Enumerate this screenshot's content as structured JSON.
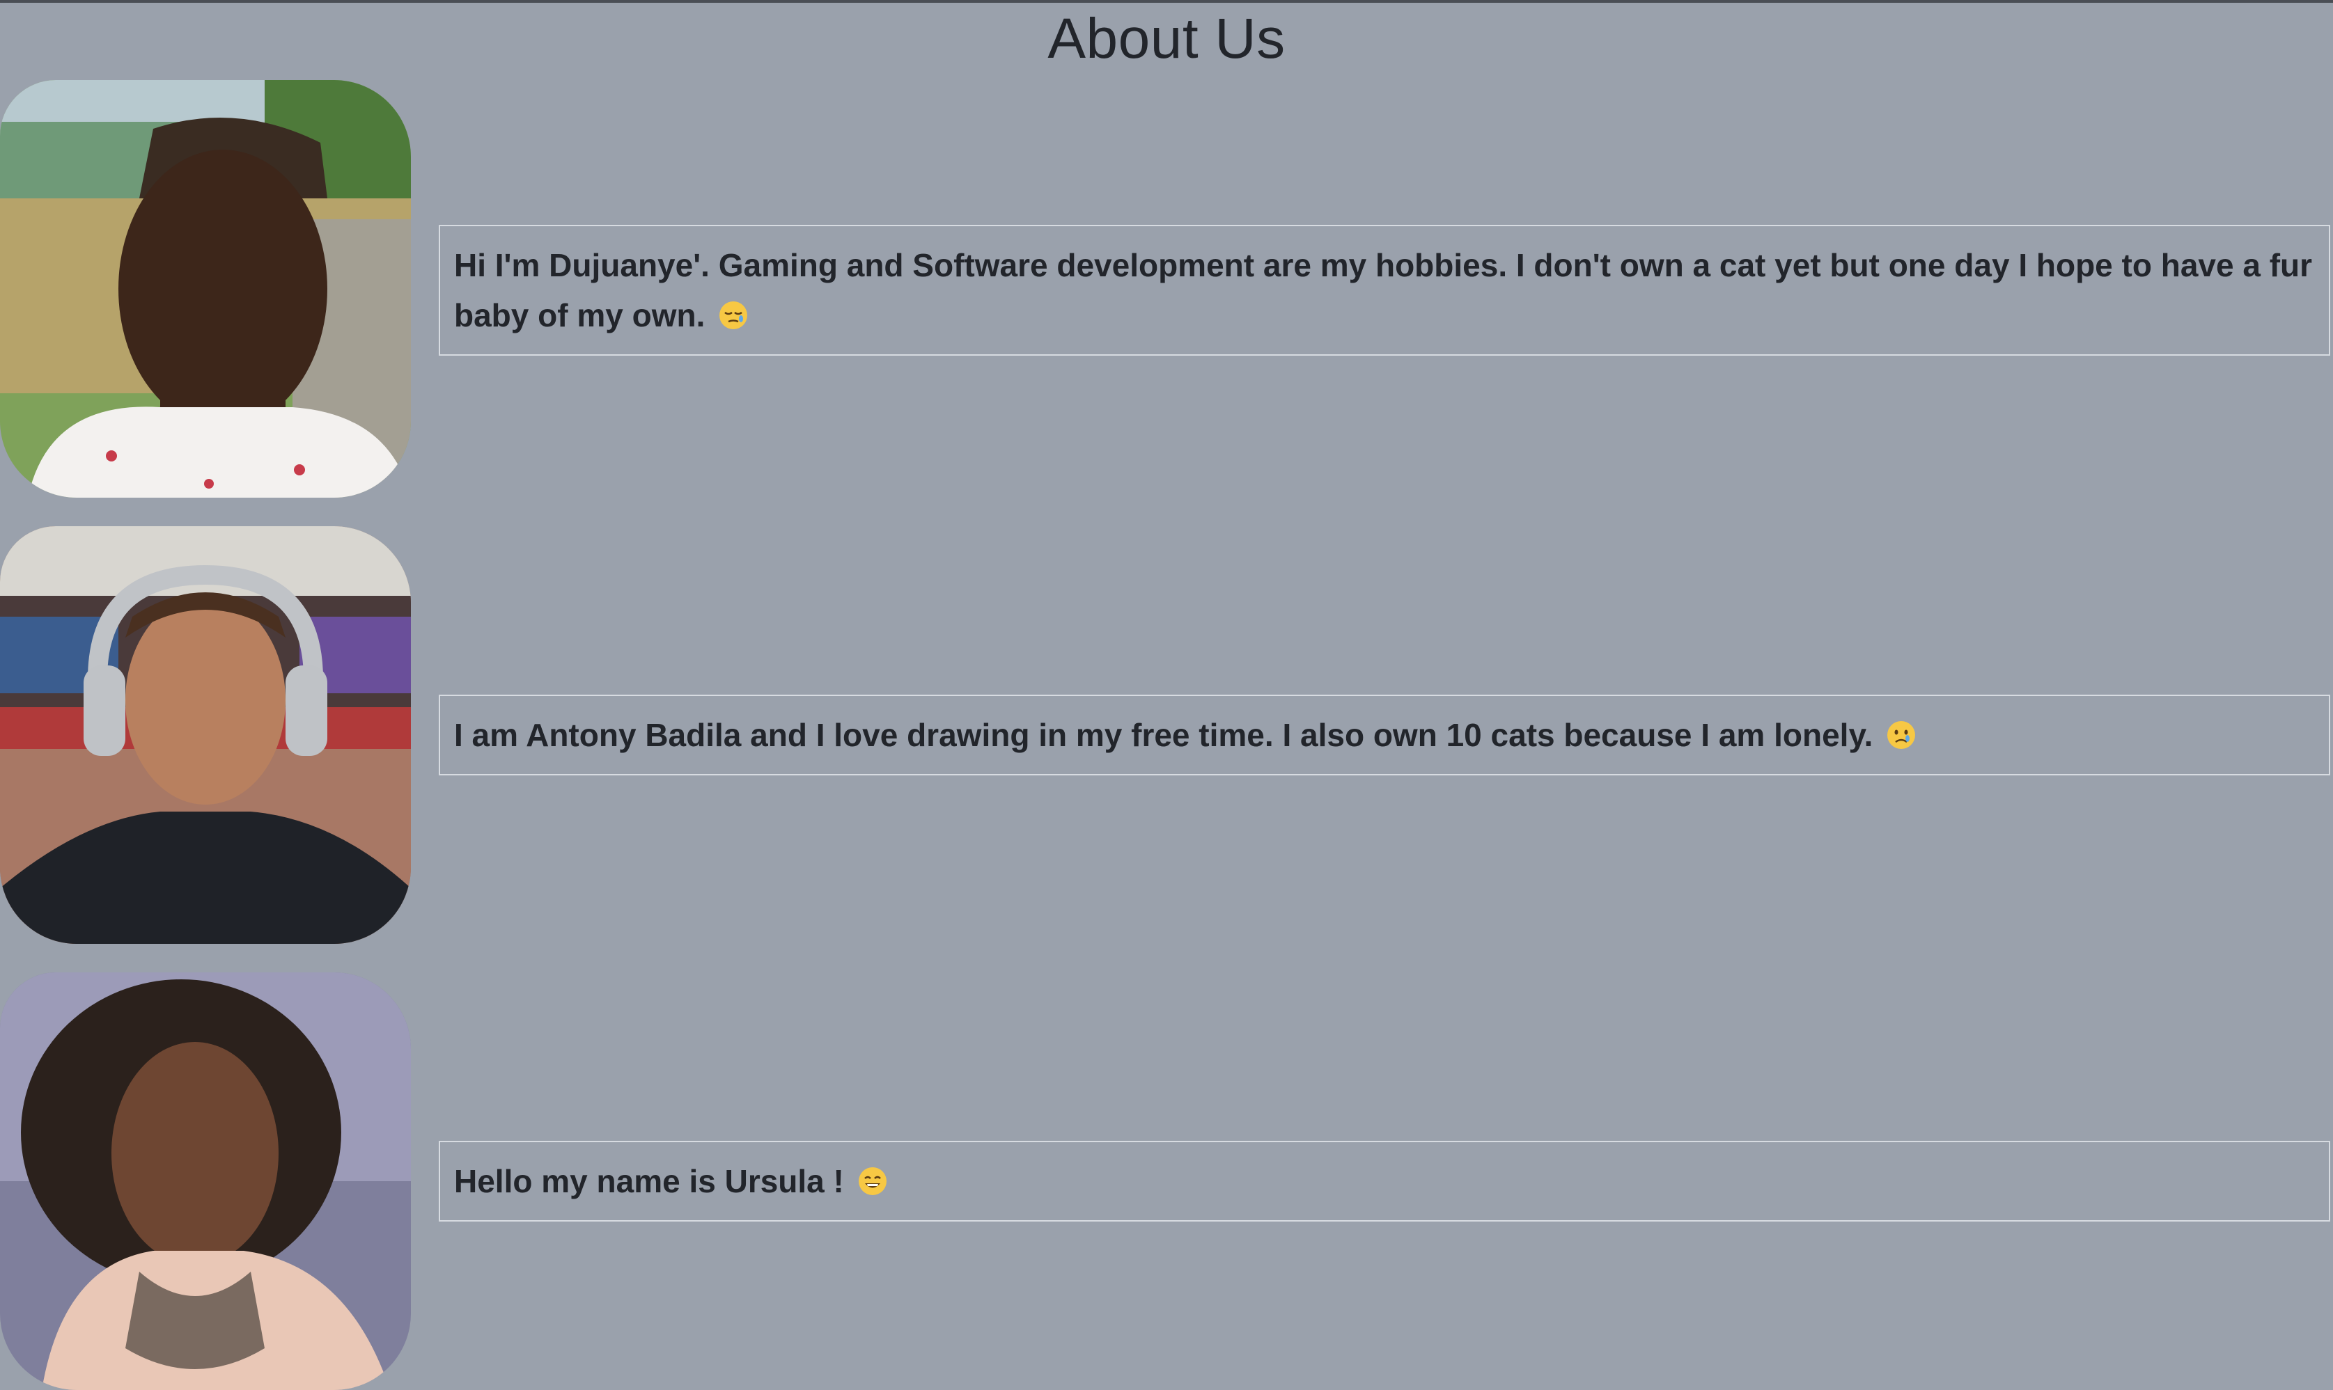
{
  "page": {
    "title": "About Us",
    "background": "#9aa1ac",
    "text_color": "#22252b"
  },
  "members": [
    {
      "bio": "Hi I'm Dujuanye'. Gaming and Software development are my hobbies. I don't own a cat yet but one day I hope to have a fur baby of my own.",
      "emoji": "sleepy-face-icon"
    },
    {
      "bio": "I am Antony Badila and I love drawing in my free time. I also own 10 cats because I am lonely.",
      "emoji": "crying-face-icon"
    },
    {
      "bio": "Hello my name is Ursula !",
      "emoji": "grinning-face-icon"
    }
  ]
}
